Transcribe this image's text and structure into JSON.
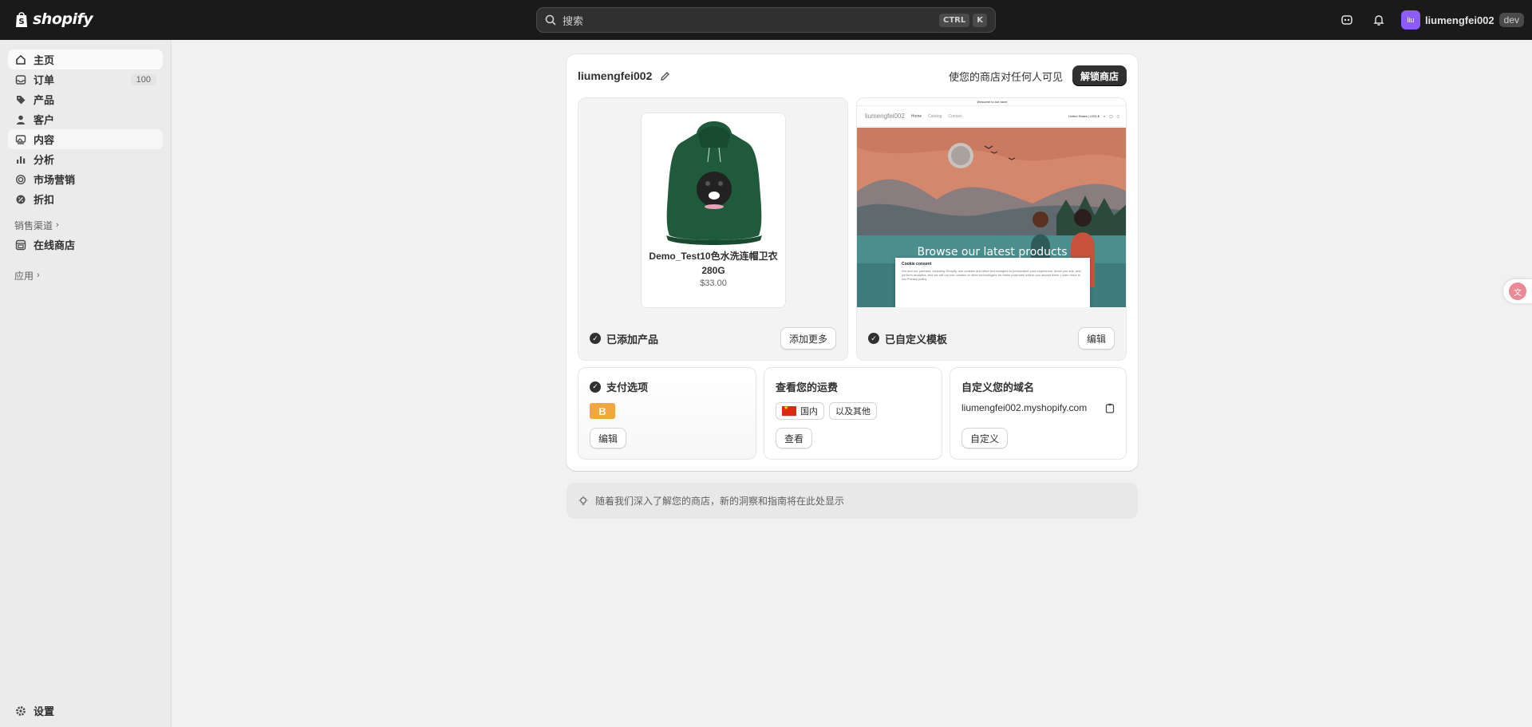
{
  "topbar": {
    "logo_text": "shopify",
    "search_placeholder": "搜索",
    "shortcut_ctrl": "CTRL",
    "shortcut_k": "K",
    "avatar_initials": "liu",
    "username": "liumengfei002",
    "badge": "dev"
  },
  "sidebar": {
    "items": [
      {
        "label": "主页",
        "icon": "home-icon"
      },
      {
        "label": "订单",
        "icon": "inbox-icon",
        "count": "100"
      },
      {
        "label": "产品",
        "icon": "tag-icon"
      },
      {
        "label": "客户",
        "icon": "person-icon"
      },
      {
        "label": "内容",
        "icon": "image-icon"
      },
      {
        "label": "分析",
        "icon": "bar-chart-icon"
      },
      {
        "label": "市场营销",
        "icon": "target-icon"
      },
      {
        "label": "折扣",
        "icon": "discount-icon"
      }
    ],
    "sales_channels_label": "销售渠道",
    "online_store_label": "在线商店",
    "apps_label": "应用",
    "settings_label": "设置"
  },
  "store_card": {
    "store_name": "liumengfei002",
    "visibility_text": "使您的商店对任何人可见",
    "unlock_button": "解锁商店",
    "product": {
      "name": "Demo_Test10色水洗连帽卫衣280G",
      "price": "$33.00"
    },
    "product_status": "已添加产品",
    "add_more_button": "添加更多",
    "theme_status": "已自定义模板",
    "edit_theme_button": "编辑",
    "preview": {
      "announcement": "Welcome to our store",
      "brand": "liumengfei002",
      "nav_home": "Home",
      "nav_catalog": "Catalog",
      "nav_contact": "Contact",
      "region": "United States | USD $",
      "hero_title": "Browse our latest products",
      "cookie_title": "Cookie consent",
      "cookie_body": "We and our partners, including Shopify, use cookies and other technologies to personalize your experience, show you ads, and perform analytics, and we will not use cookies or other technologies for these purposes unless you accept them. Learn more in our Privacy policy"
    },
    "payment": {
      "title": "支付选项",
      "logo_letter": "B",
      "edit_button": "编辑"
    },
    "shipping": {
      "title": "查看您的运费",
      "tag_domestic": "国内",
      "tag_other": "以及其他",
      "view_button": "查看"
    },
    "domain": {
      "title": "自定义您的域名",
      "domain": "liumengfei002.myshopify.com",
      "customize_button": "自定义"
    }
  },
  "insight": {
    "text": "随着我们深入了解您的商店，新的洞察和指南将在此处显示"
  },
  "colors": {
    "topbar": "#1a1a1a",
    "sidebar": "#ebebeb",
    "avatar": "#8b5cf6",
    "payment_logo": "#f1a73d"
  }
}
